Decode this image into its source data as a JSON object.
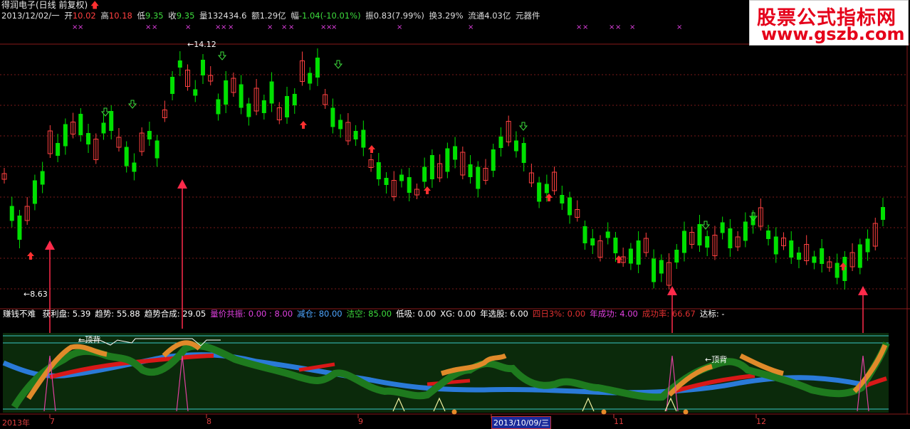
{
  "header": {
    "title": "得润电子(日线 前复权)",
    "date": "2013/12/02/一",
    "open_label": "开",
    "open": "10.02",
    "high_label": "高",
    "high": "10.18",
    "low_label": "低",
    "low": "9.35",
    "close_label": "收",
    "close": "9.35",
    "vol_label": "量",
    "vol": "132434.6",
    "amt_label": "额",
    "amt": "1.29亿",
    "chg_label": "幅",
    "chg": "-1.04(-10.01%)",
    "amp_label": "振",
    "amp": "0.83(7.99%)",
    "turn_label": "换",
    "turn": "3.29%",
    "float_label": "流通",
    "float": "4.03亿",
    "sector": "元器件"
  },
  "watermark": {
    "line1": "股票公式指标网",
    "line2": "www.gszb.com"
  },
  "annotations": {
    "high": "14.12",
    "low": "8.63",
    "top_div_1": "←顶背",
    "top_div_2": "←顶背"
  },
  "indicator": {
    "name": "赚钱不难",
    "items": [
      {
        "label": "获利盘:",
        "value": "5.39",
        "color": "#ffffff"
      },
      {
        "label": "趋势:",
        "value": "55.88",
        "color": "#ffffff"
      },
      {
        "label": "趋势合成:",
        "value": "29.05",
        "color": "#ffffff"
      },
      {
        "label": "量价共振:",
        "value": "0.00 : 8.00",
        "color": "#e040e0"
      },
      {
        "label": "减仓:",
        "value": "80.00",
        "color": "#4da6ff"
      },
      {
        "label": "洁空:",
        "value": "85.00",
        "color": "#3ddc3d"
      },
      {
        "label": "低吸:",
        "value": "0.00",
        "color": "#ffffff"
      },
      {
        "label": "XG:",
        "value": "0.00",
        "color": "#ffffff"
      },
      {
        "label": "年选股:",
        "value": "6.00",
        "color": "#ffffff"
      },
      {
        "label": "四日3%:",
        "value": "0.00",
        "color": "#e03030"
      },
      {
        "label": "年成功:",
        "value": "4.00",
        "color": "#e040e0"
      },
      {
        "label": "成功率:",
        "value": "66.67",
        "color": "#e03030"
      },
      {
        "label": "达标:",
        "value": "-",
        "color": "#ffffff"
      }
    ]
  },
  "x_axis": [
    "2013年",
    "7",
    "8",
    "9",
    "2013/10/09/三",
    "11",
    "12"
  ],
  "colors": {
    "up": "#ff4040",
    "down": "#00e000",
    "bg": "#000000",
    "grid": "#7a1a1a"
  }
}
